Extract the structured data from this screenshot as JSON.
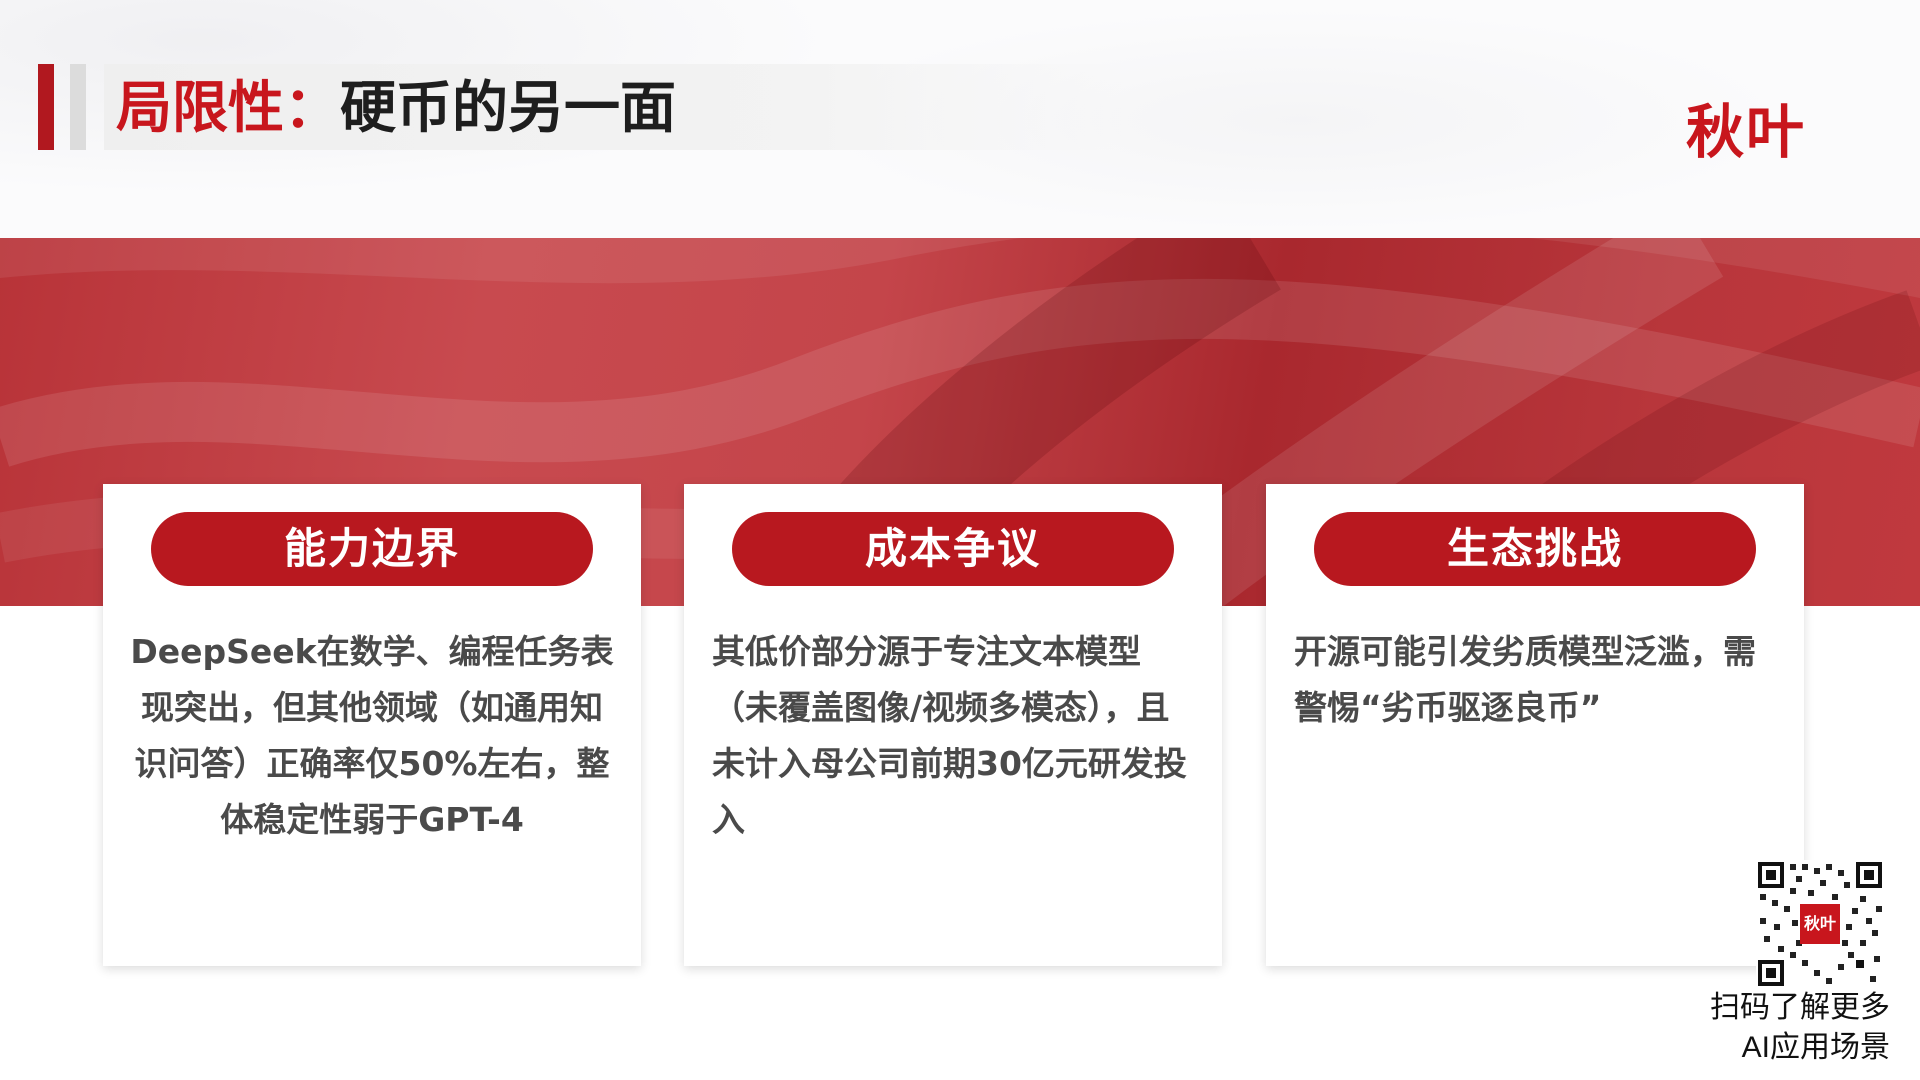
{
  "header": {
    "title_highlight": "局限性：",
    "title_rest": "硬币的另一面",
    "logo_text": "秋叶"
  },
  "cards": [
    {
      "heading": "能力边界",
      "body": "DeepSeek在数学、编程任务表现突出，但其他领域（如通用知识问答）正确率仅50%左右，整体稳定性弱于GPT-4"
    },
    {
      "heading": "成本争议",
      "body": "其低价部分源于专注文本模型（未覆盖图像/视频多模态），且未计入母公司前期30亿元研发投入"
    },
    {
      "heading": "生态挑战",
      "body": "开源可能引发劣质模型泛滥，需警惕“劣币驱逐良币”"
    }
  ],
  "qr": {
    "badge_text": "秋叶",
    "caption_line1": "扫码了解更多",
    "caption_line2": "AI应用场景"
  },
  "colors": {
    "accent_red": "#c8161d",
    "pill_red": "#b8181f",
    "body_text": "#4a4a4a",
    "title_dark": "#1e1e1e"
  }
}
